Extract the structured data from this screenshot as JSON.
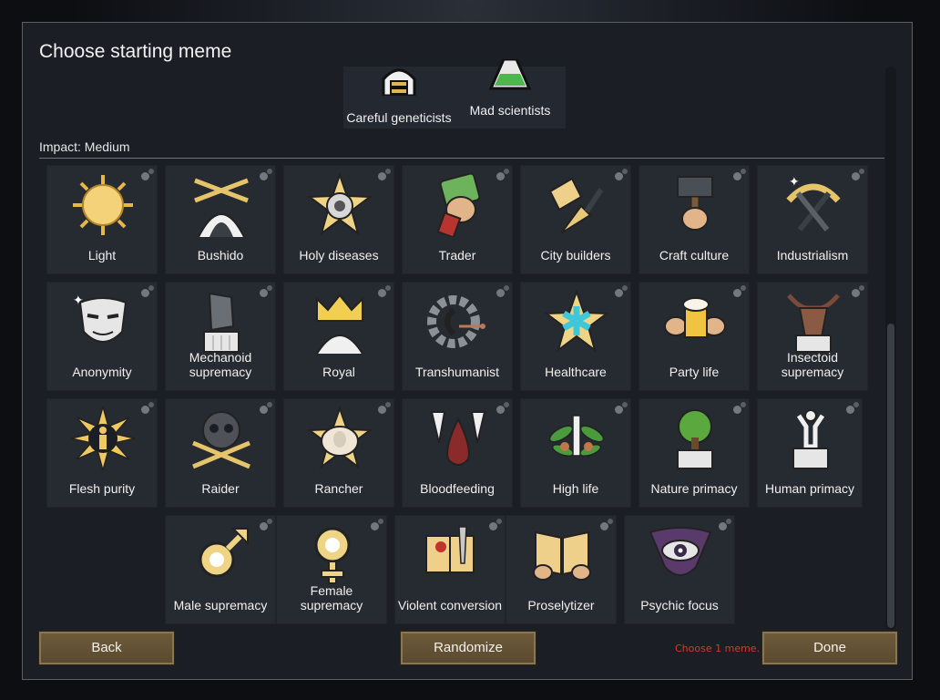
{
  "dialog": {
    "title": "Choose starting meme",
    "impact_label": "Impact: Medium",
    "warning": "Choose 1 meme.",
    "buttons": {
      "back": "Back",
      "randomize": "Randomize",
      "done": "Done"
    }
  },
  "top_memes": [
    {
      "label": "Careful geneticists",
      "icon": "helmet-icon"
    },
    {
      "label": "Mad scientists",
      "icon": "flask-icon"
    }
  ],
  "memes": [
    {
      "label": "Light",
      "icon": "sun-icon"
    },
    {
      "label": "Bushido",
      "icon": "crossed-swords-icon"
    },
    {
      "label": "Holy diseases",
      "icon": "virus-star-icon"
    },
    {
      "label": "Trader",
      "icon": "money-hand-icon"
    },
    {
      "label": "City builders",
      "icon": "trowel-icon"
    },
    {
      "label": "Craft culture",
      "icon": "hammer-hand-icon"
    },
    {
      "label": "Industrialism",
      "icon": "pickaxe-icon"
    },
    {
      "label": "Anonymity",
      "icon": "mask-icon"
    },
    {
      "label": "Mechanoid supremacy",
      "icon": "mech-pillar-icon"
    },
    {
      "label": "Royal",
      "icon": "crown-icon"
    },
    {
      "label": "Transhumanist",
      "icon": "cyber-gear-icon"
    },
    {
      "label": "Healthcare",
      "icon": "medical-star-icon"
    },
    {
      "label": "Party life",
      "icon": "beer-mug-icon"
    },
    {
      "label": "Insectoid supremacy",
      "icon": "insect-pillar-icon"
    },
    {
      "label": "Flesh purity",
      "icon": "human-burst-icon"
    },
    {
      "label": "Raider",
      "icon": "skull-swords-icon"
    },
    {
      "label": "Rancher",
      "icon": "sheep-icon"
    },
    {
      "label": "Bloodfeeding",
      "icon": "fangs-icon"
    },
    {
      "label": "High life",
      "icon": "leaf-syringe-icon"
    },
    {
      "label": "Nature primacy",
      "icon": "tree-pillar-icon"
    },
    {
      "label": "Human primacy",
      "icon": "human-pillar-icon"
    },
    {
      "label": "Male supremacy",
      "icon": "male-symbol-icon"
    },
    {
      "label": "Female supremacy",
      "icon": "female-symbol-icon"
    },
    {
      "label": "Violent conversion",
      "icon": "book-knife-icon"
    },
    {
      "label": "Proselytizer",
      "icon": "open-book-icon"
    },
    {
      "label": "Psychic focus",
      "icon": "psychic-eye-icon"
    }
  ]
}
